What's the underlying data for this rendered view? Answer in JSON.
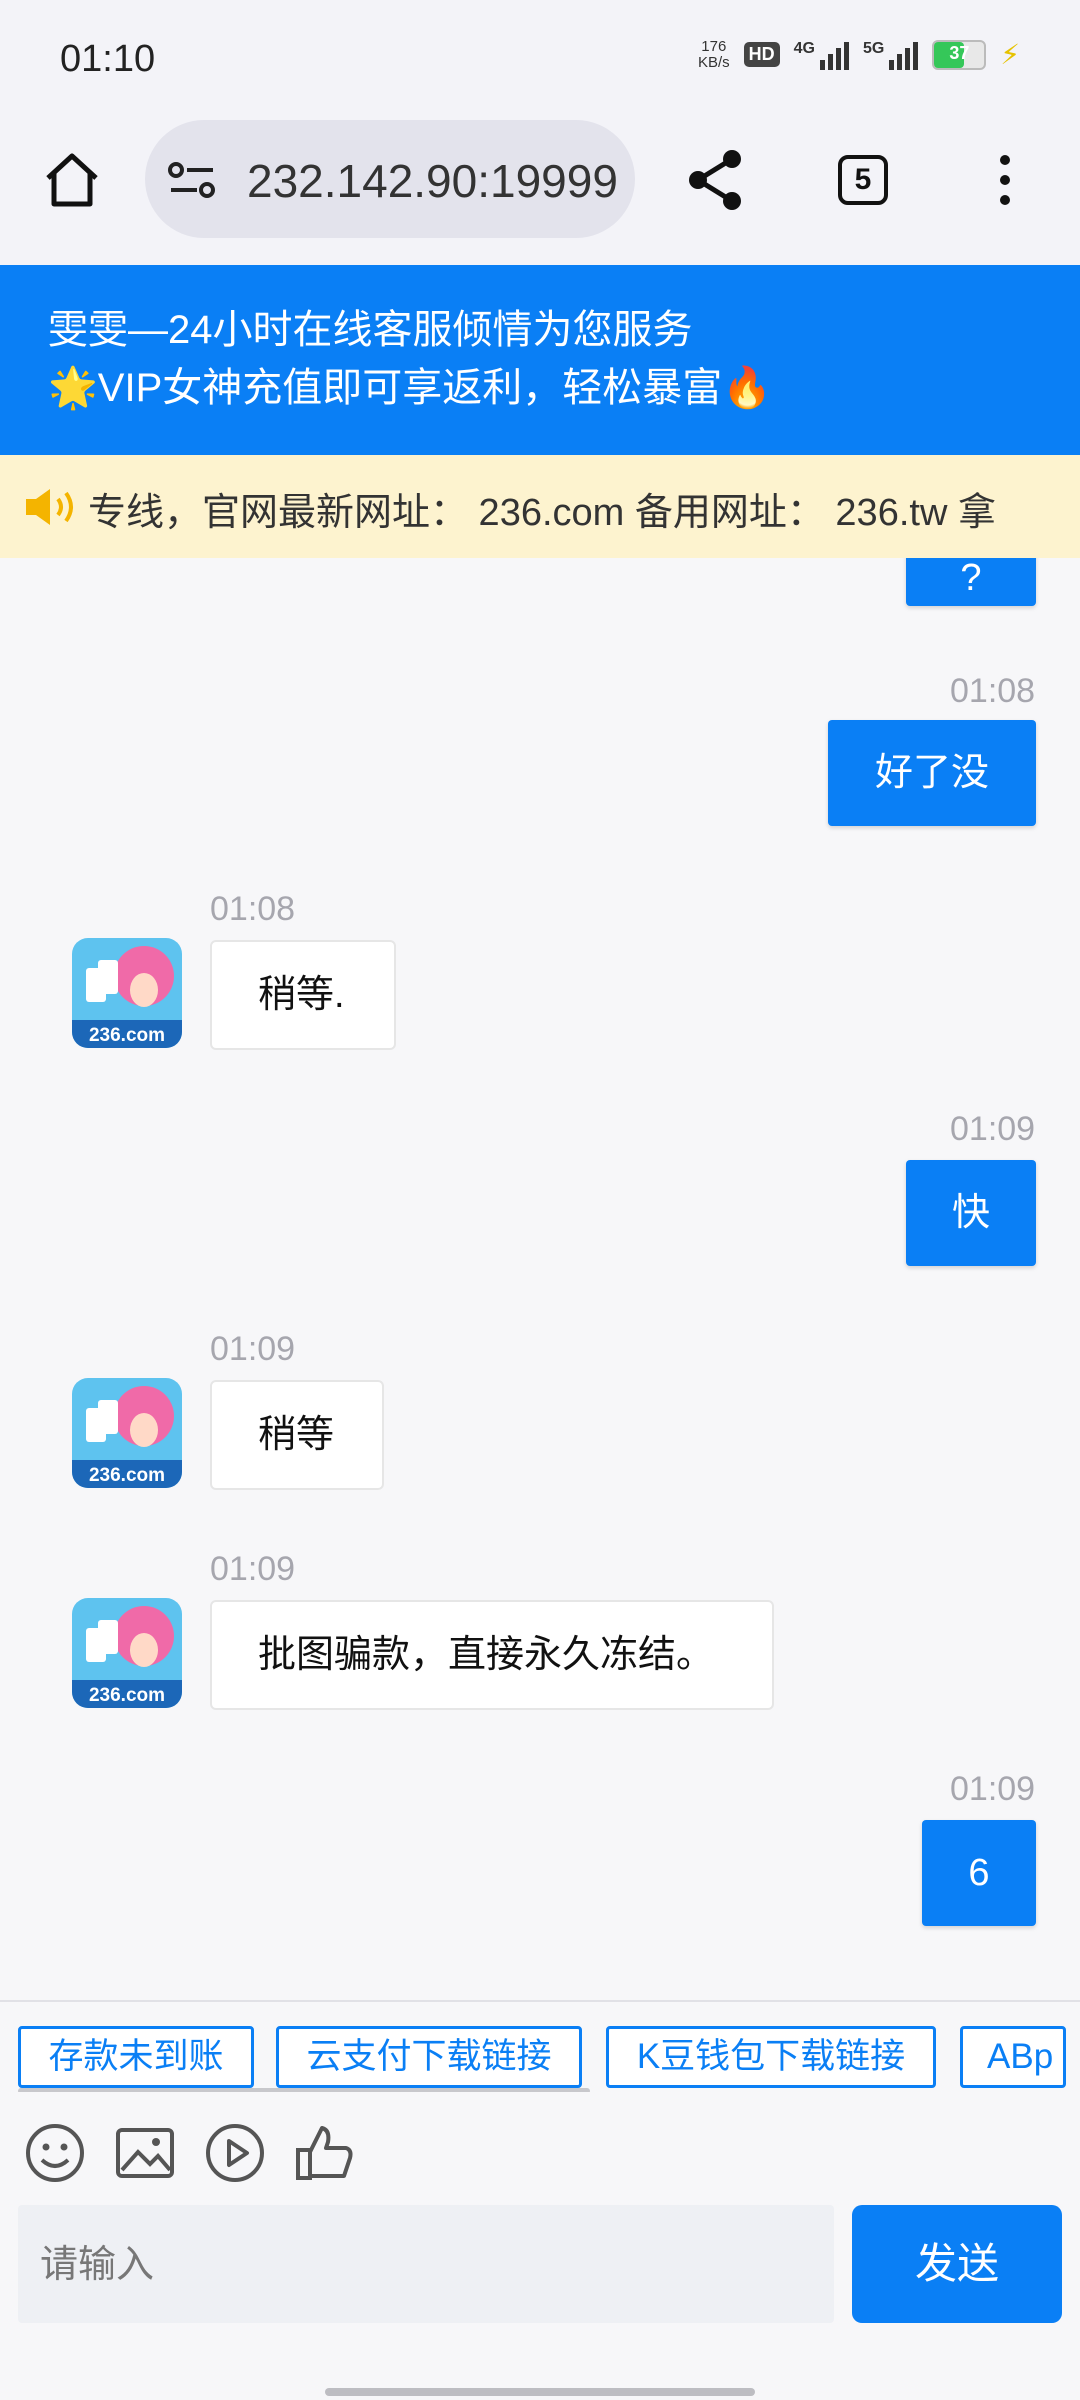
{
  "status": {
    "time": "01:10",
    "net_speed_value": "176",
    "net_speed_unit": "KB/s",
    "hd_label": "HD",
    "sim1_label": "4G",
    "sim2_label": "5G",
    "battery_level": "37"
  },
  "browser": {
    "url": "232.142.90:19999",
    "tab_count": "5"
  },
  "banner": {
    "line1": "雯雯—24小时在线客服倾情为您服务",
    "line2": "🌟VIP女神充值即可享返利，轻松暴富🔥"
  },
  "notice": {
    "text": "专线，官网最新网址： 236.com 备用网址： 236.tw 拿"
  },
  "avatar_label": "236.com",
  "messages": [
    {
      "side": "out",
      "time": "",
      "text": "?"
    },
    {
      "side": "out",
      "time": "01:08",
      "text": "好了没"
    },
    {
      "side": "in",
      "time": "01:08",
      "text": "稍等."
    },
    {
      "side": "out",
      "time": "01:09",
      "text": "快"
    },
    {
      "side": "in",
      "time": "01:09",
      "text": "稍等"
    },
    {
      "side": "in",
      "time": "01:09",
      "text": "批图骗款，直接永久冻结。"
    },
    {
      "side": "out",
      "time": "01:09",
      "text": "6"
    }
  ],
  "quick_replies": [
    "存款未到账",
    "云支付下载链接",
    "K豆钱包下载链接",
    "ABp"
  ],
  "input": {
    "placeholder": "请输入",
    "send_label": "发送"
  }
}
